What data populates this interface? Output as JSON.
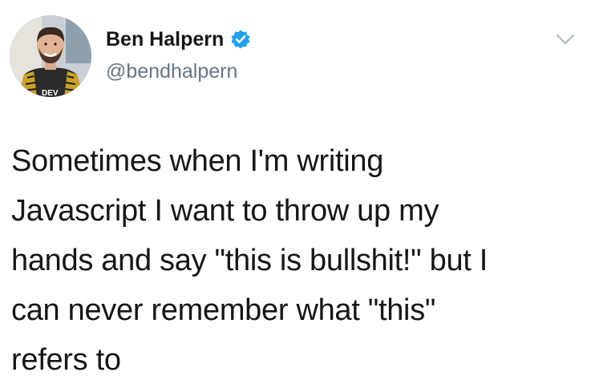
{
  "user": {
    "display_name": "Ben Halpern",
    "handle": "@bendhalpern",
    "verified": true,
    "avatar_icon": "profile-photo"
  },
  "tweet": {
    "text_lines": [
      "Sometimes when I'm writing",
      "Javascript I want to throw up my",
      "hands and say \"this is bullshit!\" but I",
      "can never remember what \"this\"",
      "refers to"
    ]
  },
  "icons": {
    "verified": "verified-badge-icon",
    "menu": "chevron-down-icon"
  },
  "colors": {
    "text": "#14171a",
    "secondary": "#657786",
    "verified_blue": "#1da1f2",
    "chevron": "#aab8c2"
  }
}
